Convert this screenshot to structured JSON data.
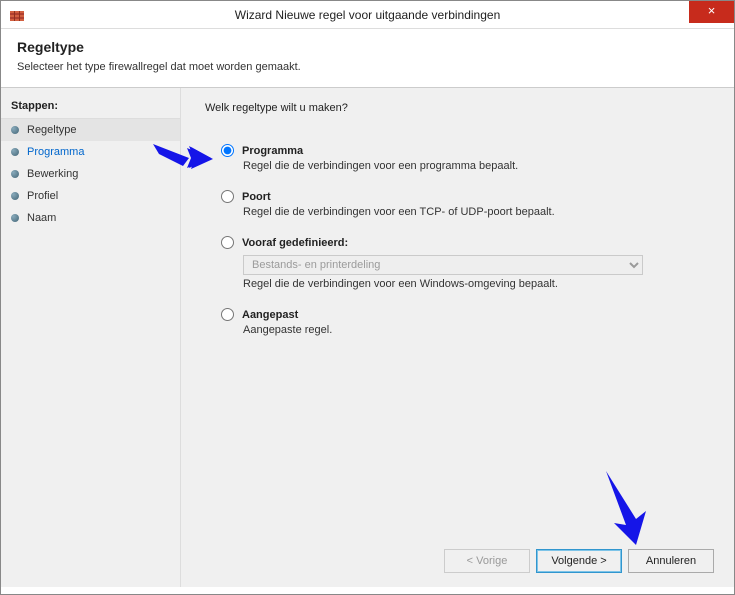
{
  "window": {
    "title": "Wizard Nieuwe regel voor uitgaande verbindingen",
    "close": "×"
  },
  "header": {
    "title": "Regeltype",
    "subtitle": "Selecteer het type firewallregel dat moet worden gemaakt."
  },
  "sidebar": {
    "title": "Stappen:",
    "items": [
      {
        "label": "Regeltype",
        "active": true
      },
      {
        "label": "Programma",
        "link": true
      },
      {
        "label": "Bewerking"
      },
      {
        "label": "Profiel"
      },
      {
        "label": "Naam"
      }
    ]
  },
  "main": {
    "question": "Welk regeltype wilt u maken?",
    "options": [
      {
        "label": "Programma",
        "desc": "Regel die de verbindingen voor een programma bepaalt.",
        "selected": true
      },
      {
        "label": "Poort",
        "desc": "Regel die de verbindingen voor een TCP- of UDP-poort bepaalt."
      },
      {
        "label": "Vooraf gedefinieerd:",
        "desc": "Regel die de verbindingen voor een Windows-omgeving bepaalt.",
        "dropdown": "Bestands- en printerdeling"
      },
      {
        "label": "Aangepast",
        "desc": "Aangepaste regel."
      }
    ]
  },
  "buttons": {
    "back": "< Vorige",
    "next": "Volgende >",
    "cancel": "Annuleren"
  }
}
